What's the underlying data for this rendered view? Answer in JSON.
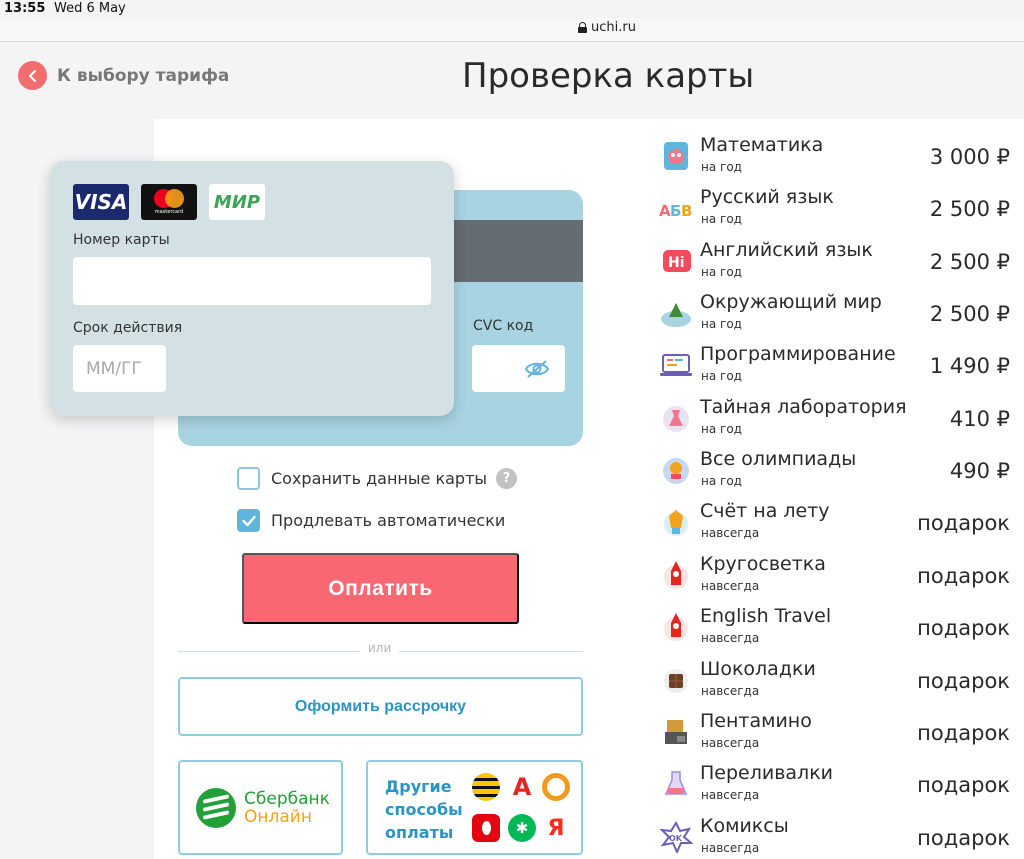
{
  "status_bar": {
    "time": "13:55",
    "date": "Wed 6 May"
  },
  "browser": {
    "url": "uchi.ru"
  },
  "header": {
    "back_label": "К выбору тарифа",
    "title": "Проверка карты"
  },
  "card_form": {
    "brands": [
      "VISA",
      "mastercard",
      "МИР"
    ],
    "card_number_label": "Номер карты",
    "card_number_value": "",
    "expiry_label": "Срок действия",
    "expiry_placeholder": "ММ/ГГ",
    "cvc_label": "CVC код",
    "cvc_value": ""
  },
  "options": {
    "save_card_label": "Сохранить данные карты",
    "save_card_checked": false,
    "help_symbol": "?",
    "auto_renew_label": "Продлевать автоматически",
    "auto_renew_checked": true
  },
  "actions": {
    "pay_label": "Оплатить",
    "or_label": "или",
    "installment_label": "Оформить рассрочку",
    "sber_line1": "Сбербанк",
    "sber_line2": "Онлайн",
    "other_line1": "Другие",
    "other_line2": "способы",
    "other_line3": "оплаты"
  },
  "items": [
    {
      "name": "Математика",
      "period": "на год",
      "price": "3 000 ₽",
      "icon": "math-icon"
    },
    {
      "name": "Русский язык",
      "period": "на год",
      "price": "2 500 ₽",
      "icon": "abc-icon"
    },
    {
      "name": "Английский язык",
      "period": "на год",
      "price": "2 500 ₽",
      "icon": "hi-icon"
    },
    {
      "name": "Окружающий мир",
      "period": "на год",
      "price": "2 500 ₽",
      "icon": "world-icon"
    },
    {
      "name": "Программирование",
      "period": "на год",
      "price": "1 490 ₽",
      "icon": "laptop-icon"
    },
    {
      "name": "Тайная лаборатория",
      "period": "на год",
      "price": "410 ₽",
      "icon": "lab-icon"
    },
    {
      "name": "Все олимпиады",
      "period": "на год",
      "price": "490 ₽",
      "icon": "olympiad-icon"
    },
    {
      "name": "Счёт на лету",
      "period": "навсегда",
      "price": "подарок",
      "icon": "count-icon"
    },
    {
      "name": "Кругосветка",
      "period": "навсегда",
      "price": "подарок",
      "icon": "rocket-icon"
    },
    {
      "name": "English Travel",
      "period": "навсегда",
      "price": "подарок",
      "icon": "rocket-icon"
    },
    {
      "name": "Шоколадки",
      "period": "навсегда",
      "price": "подарок",
      "icon": "chocolate-icon"
    },
    {
      "name": "Пентамино",
      "period": "навсегда",
      "price": "подарок",
      "icon": "pentamino-icon"
    },
    {
      "name": "Переливалки",
      "period": "навсегда",
      "price": "подарок",
      "icon": "flask-icon"
    },
    {
      "name": "Комиксы",
      "period": "навсегда",
      "price": "подарок",
      "icon": "comics-icon"
    }
  ],
  "colors": {
    "accent_red": "#f96772",
    "accent_blue": "#2b94c4",
    "sber_green": "#21a038",
    "card_front": "#d4e1e4",
    "card_back": "#a8d4e2"
  }
}
